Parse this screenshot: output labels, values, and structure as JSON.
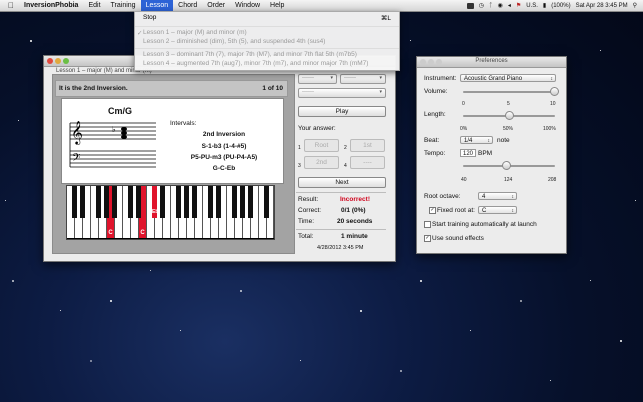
{
  "menubar": {
    "app_name": "InversionPhobia",
    "items": [
      "Edit",
      "Training",
      "Lesson",
      "Chord",
      "Order",
      "Window",
      "Help"
    ],
    "status": {
      "battery": "(100%)",
      "clock": "Sat Apr 28  3:45 PM",
      "input_source": "U.S."
    }
  },
  "lesson_menu": {
    "stop_label": "Stop",
    "stop_shortcut": "⌘L",
    "items": [
      "Lesson 1 – major (M) and minor (m)",
      "Lesson 2 – diminished (dim), 5th (5), and suspended 4th (sus4)",
      "Lesson 3 – dominant 7th (7), major 7th (M7), and minor 7th flat 5th (m7b5)",
      "Lesson 4 – augmented 7th (aug7), minor 7th (m7), and minor major 7th (mM7)"
    ]
  },
  "main_window": {
    "title": "Lesson 1 – major (M) and minor (m)",
    "info_text": "It is the 2nd Inversion.",
    "counter": "1 of 10",
    "card": {
      "chord_name": "Cm/G",
      "intervals_label": "Intervals:",
      "interval_lines": [
        "2nd Inversion",
        "S-1-b3 (1-4-#5)",
        "P5-PU-m3 (PU-P4-A5)",
        "G-C-Eb"
      ]
    },
    "piano_labels": [
      "C",
      "C",
      "Eb"
    ],
    "play_label": "Play",
    "your_answer_label": "Your answer:",
    "answer_buttons": [
      {
        "num": "1",
        "label": "Root"
      },
      {
        "num": "2",
        "label": "1st"
      },
      {
        "num": "3",
        "label": "2nd"
      },
      {
        "num": "4",
        "label": "----"
      }
    ],
    "popup_placeholder": "------",
    "next_label": "Next",
    "result_label": "Result:",
    "result_value": "Incorrect!",
    "correct_label": "Correct:",
    "correct_value": "0/1 (0%)",
    "time_label": "Time:",
    "time_value": "20 seconds",
    "total_label": "Total:",
    "total_value": "1 minute",
    "timestamp": "4/28/2012 3:45 PM",
    "colors": {
      "result_incorrect": "#d0021b",
      "key_highlight": "#e0142c"
    }
  },
  "preferences": {
    "title": "Preferences",
    "instrument_label": "Instrument:",
    "instrument_value": "Acoustic Grand Piano",
    "volume_label": "Volume:",
    "volume_ticks": [
      "0",
      "5",
      "10"
    ],
    "volume_level": 1.0,
    "length_label": "Length:",
    "length_ticks": [
      "0%",
      "50%",
      "100%"
    ],
    "length_level": 0.5,
    "beat_label": "Beat:",
    "beat_value": "1/4",
    "beat_unit": "note",
    "tempo_label": "Tempo:",
    "tempo_value": "120",
    "tempo_unit": "BPM",
    "tempo_ticks": [
      "40",
      "124",
      "208"
    ],
    "tempo_level": 0.476,
    "root_octave_label": "Root octave:",
    "root_octave_value": "4",
    "fixed_root_label": "Fixed root at:",
    "fixed_root_value": "C",
    "fixed_root_checked": true,
    "start_training_label": "Start training automatically at launch",
    "start_training_checked": false,
    "sound_effects_label": "Use sound effects",
    "sound_effects_checked": true
  }
}
